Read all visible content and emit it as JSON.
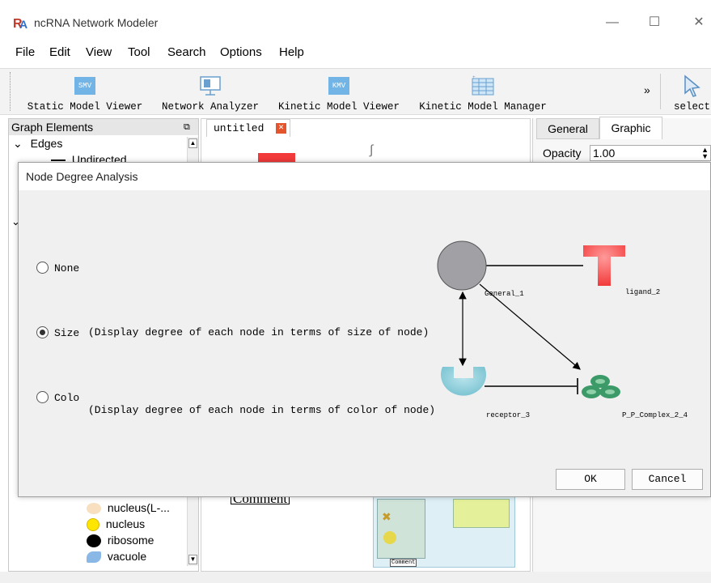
{
  "app": {
    "title": "ncRNA Network Modeler"
  },
  "window_controls": {
    "minimize": "—",
    "maximize": "☐",
    "close": "✕"
  },
  "menu": [
    "File",
    "Edit",
    "View",
    "Tool",
    "Search",
    "Options",
    "Help"
  ],
  "toolbar": {
    "buttons": [
      {
        "label": "Static Model Viewer",
        "icon_text": "SMV"
      },
      {
        "label": "Network Analyzer",
        "icon_text": ""
      },
      {
        "label": "Kinetic Model Viewer",
        "icon_text": "KMV"
      },
      {
        "label": "Kinetic Model Manager",
        "icon_text": ""
      }
    ],
    "overflow": "»",
    "select_label": "select"
  },
  "left_panel": {
    "title": "Graph Elements",
    "edges_label": "Edges",
    "undirected_label": "Undirected",
    "items": [
      "nucleus(L-...",
      "nucleus",
      "ribosome",
      "vacuole"
    ]
  },
  "canvas": {
    "tab_label": "untitled",
    "comment_label": "Comment",
    "thumb_comment": "Comment"
  },
  "right_panel": {
    "tabs": [
      "General",
      "Graphic"
    ],
    "opacity_label": "Opacity",
    "opacity_value": "1.00"
  },
  "dialog": {
    "title": "Node Degree Analysis",
    "options": [
      {
        "label": "None",
        "description": "",
        "checked": false
      },
      {
        "label": "Size",
        "description": "(Display degree of each node in terms of size of node)",
        "checked": true
      },
      {
        "label": "Colo",
        "description": "(Display degree of each node in terms of color of node)",
        "checked": false
      }
    ],
    "nodes": {
      "general": "General_1",
      "ligand": "ligand_2",
      "receptor": "receptor_3",
      "complex": "P_P_Complex_2_4"
    },
    "ok_label": "OK",
    "cancel_label": "Cancel"
  },
  "colors": {
    "general_node": "#a0a0a5",
    "ligand": "#f23a3a",
    "receptor": "#7cc4d2",
    "complex": "#3c9a68"
  }
}
